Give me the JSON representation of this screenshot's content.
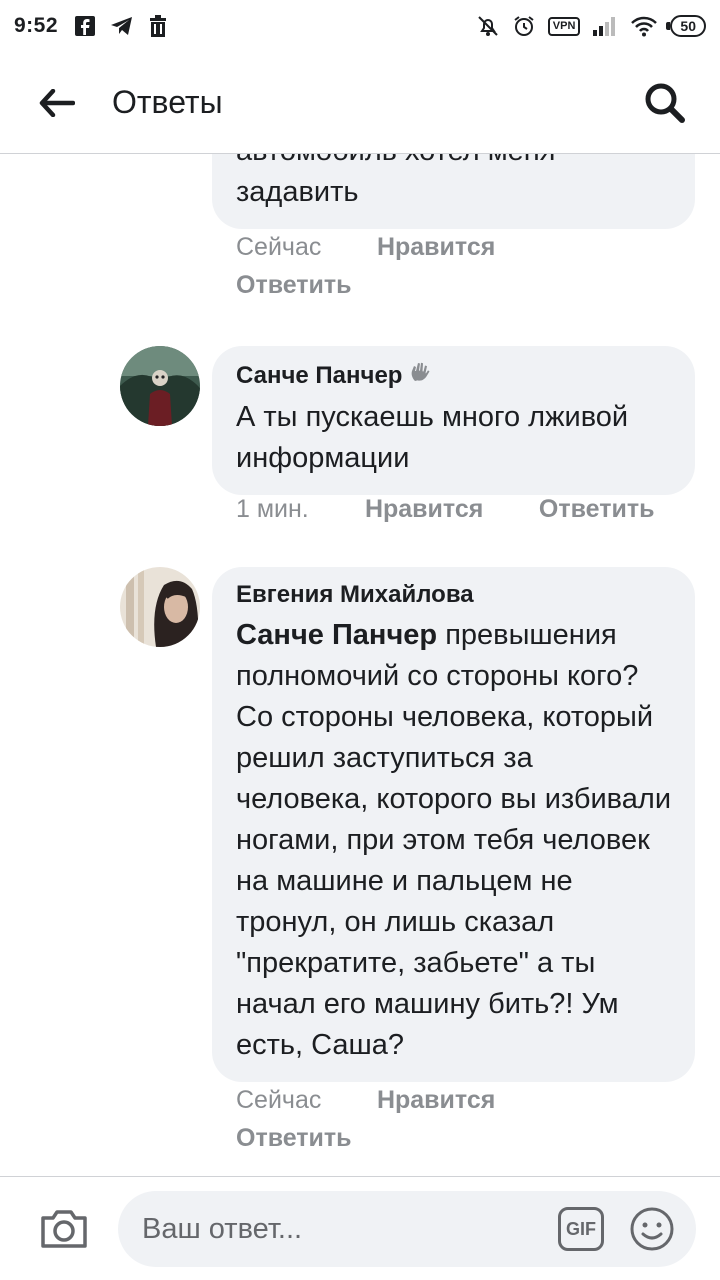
{
  "status_bar": {
    "time": "9:52",
    "vpn": "VPN",
    "battery": "50"
  },
  "header": {
    "title": "Ответы"
  },
  "comments": [
    {
      "author": "",
      "text": "автомобиль хотел меня задавить",
      "time": "Сейчас",
      "like": "Нравится",
      "reply": "Ответить"
    },
    {
      "author": "Санче Панчер",
      "text": "А ты пускаешь много лживой информации",
      "time": "1 мин.",
      "like": "Нравится",
      "reply": "Ответить"
    },
    {
      "author": "Евгения Михайлова",
      "mention": "Санче Панчер",
      "text": " превышения полномочий со стороны кого? Со стороны человека, который решил заступиться за человека, которого вы избивали ногами, при этом тебя человек на машине и пальцем не тронул, он лишь сказал \"прекратите, забьете\" а ты начал его машину бить?! Ум есть, Саша?",
      "time": "Сейчас",
      "like": "Нравится",
      "reply": "Ответить"
    }
  ],
  "composer": {
    "placeholder": "Ваш ответ...",
    "gif_label": "GIF"
  },
  "colors": {
    "bubble": "#f0f2f5",
    "meta_text": "#8a8d91",
    "text": "#1c1e21"
  },
  "icons": {
    "back": "arrow-left-icon",
    "search": "search-icon",
    "camera": "camera-icon",
    "gif": "gif-icon",
    "emoji": "emoji-icon",
    "wave": "waving-hand-icon"
  }
}
